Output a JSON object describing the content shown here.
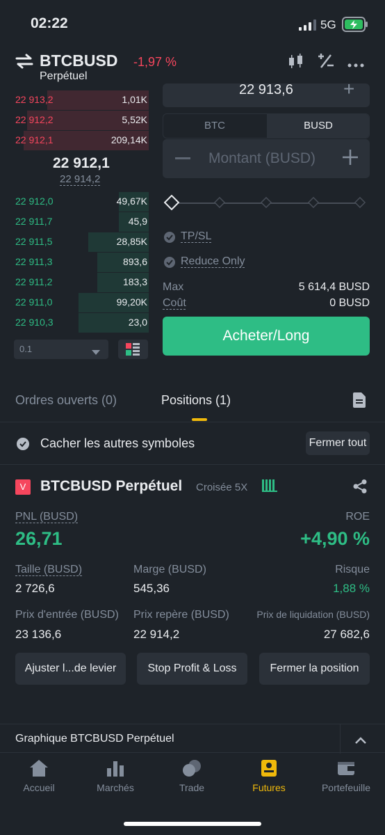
{
  "status_bar": {
    "time": "02:22",
    "network": "5G"
  },
  "header": {
    "symbol": "BTCBUSD",
    "change": "-1,97 %",
    "subtitle": "Perpétuel"
  },
  "order_book": {
    "asks": [
      {
        "price": "22 913,2",
        "qty": "1,01K",
        "depth": 0.75
      },
      {
        "price": "22 912,2",
        "qty": "5,52K",
        "depth": 0.9
      },
      {
        "price": "22 912,1",
        "qty": "209,14K",
        "depth": 0.93
      }
    ],
    "last_price": "22 912,1",
    "mark_price": "22 914,2",
    "bids": [
      {
        "price": "22 912,0",
        "qty": "49,67K",
        "depth": 0.22
      },
      {
        "price": "22 911,7",
        "qty": "45,9",
        "depth": 0.22
      },
      {
        "price": "22 911,5",
        "qty": "28,85K",
        "depth": 0.45
      },
      {
        "price": "22 911,3",
        "qty": "893,6",
        "depth": 0.38
      },
      {
        "price": "22 911,2",
        "qty": "183,3",
        "depth": 0.38
      },
      {
        "price": "22 911,0",
        "qty": "99,20K",
        "depth": 0.52
      },
      {
        "price": "22 910,3",
        "qty": "23,0",
        "depth": 0.52
      }
    ],
    "precision": "0.1"
  },
  "order_form": {
    "price_partial": "22 913,6",
    "currency_tabs": [
      "BTC",
      "BUSD"
    ],
    "amount_placeholder": "Montant (BUSD)",
    "tpsl_label": "TP/SL",
    "reduce_only_label": "Reduce Only",
    "max_label": "Max",
    "max_value": "5 614,4 BUSD",
    "cost_label": "Coût",
    "cost_value": "0 BUSD",
    "buy_button": "Acheter/Long"
  },
  "tabs": {
    "open_orders": "Ordres ouverts (0)",
    "positions": "Positions (1)"
  },
  "filter": {
    "hide_others": "Cacher les autres symboles",
    "close_all": "Fermer tout"
  },
  "position": {
    "badge": "V",
    "symbol": "BTCBUSD Perpétuel",
    "margin_mode": "Croisée 5X",
    "pnl_label": "PNL (BUSD)",
    "pnl_value": "26,71",
    "roe_label": "ROE",
    "roe_value": "+4,90 %",
    "size_label": "Taille (BUSD)",
    "size_value": "2 726,6",
    "margin_label": "Marge (BUSD)",
    "margin_value": "545,36",
    "risk_label": "Risque",
    "risk_value": "1,88 %",
    "entry_label": "Prix d'entrée (BUSD)",
    "entry_value": "23 136,6",
    "mark_label": "Prix repère (BUSD)",
    "mark_value": "22 914,2",
    "liq_label": "Prix de liquidation (BUSD)",
    "liq_value": "27 682,6",
    "btn_leverage": "Ajuster l...de levier",
    "btn_tpsl": "Stop Profit & Loss",
    "btn_close": "Fermer la position"
  },
  "chart_bar": {
    "label": "Graphique BTCBUSD Perpétuel"
  },
  "nav": {
    "home": "Accueil",
    "markets": "Marchés",
    "trade": "Trade",
    "futures": "Futures",
    "wallet": "Portefeuille"
  },
  "colors": {
    "accent": "#f0b90b",
    "green": "#2ebd85",
    "red": "#f6465d",
    "bg": "#1e2329"
  }
}
